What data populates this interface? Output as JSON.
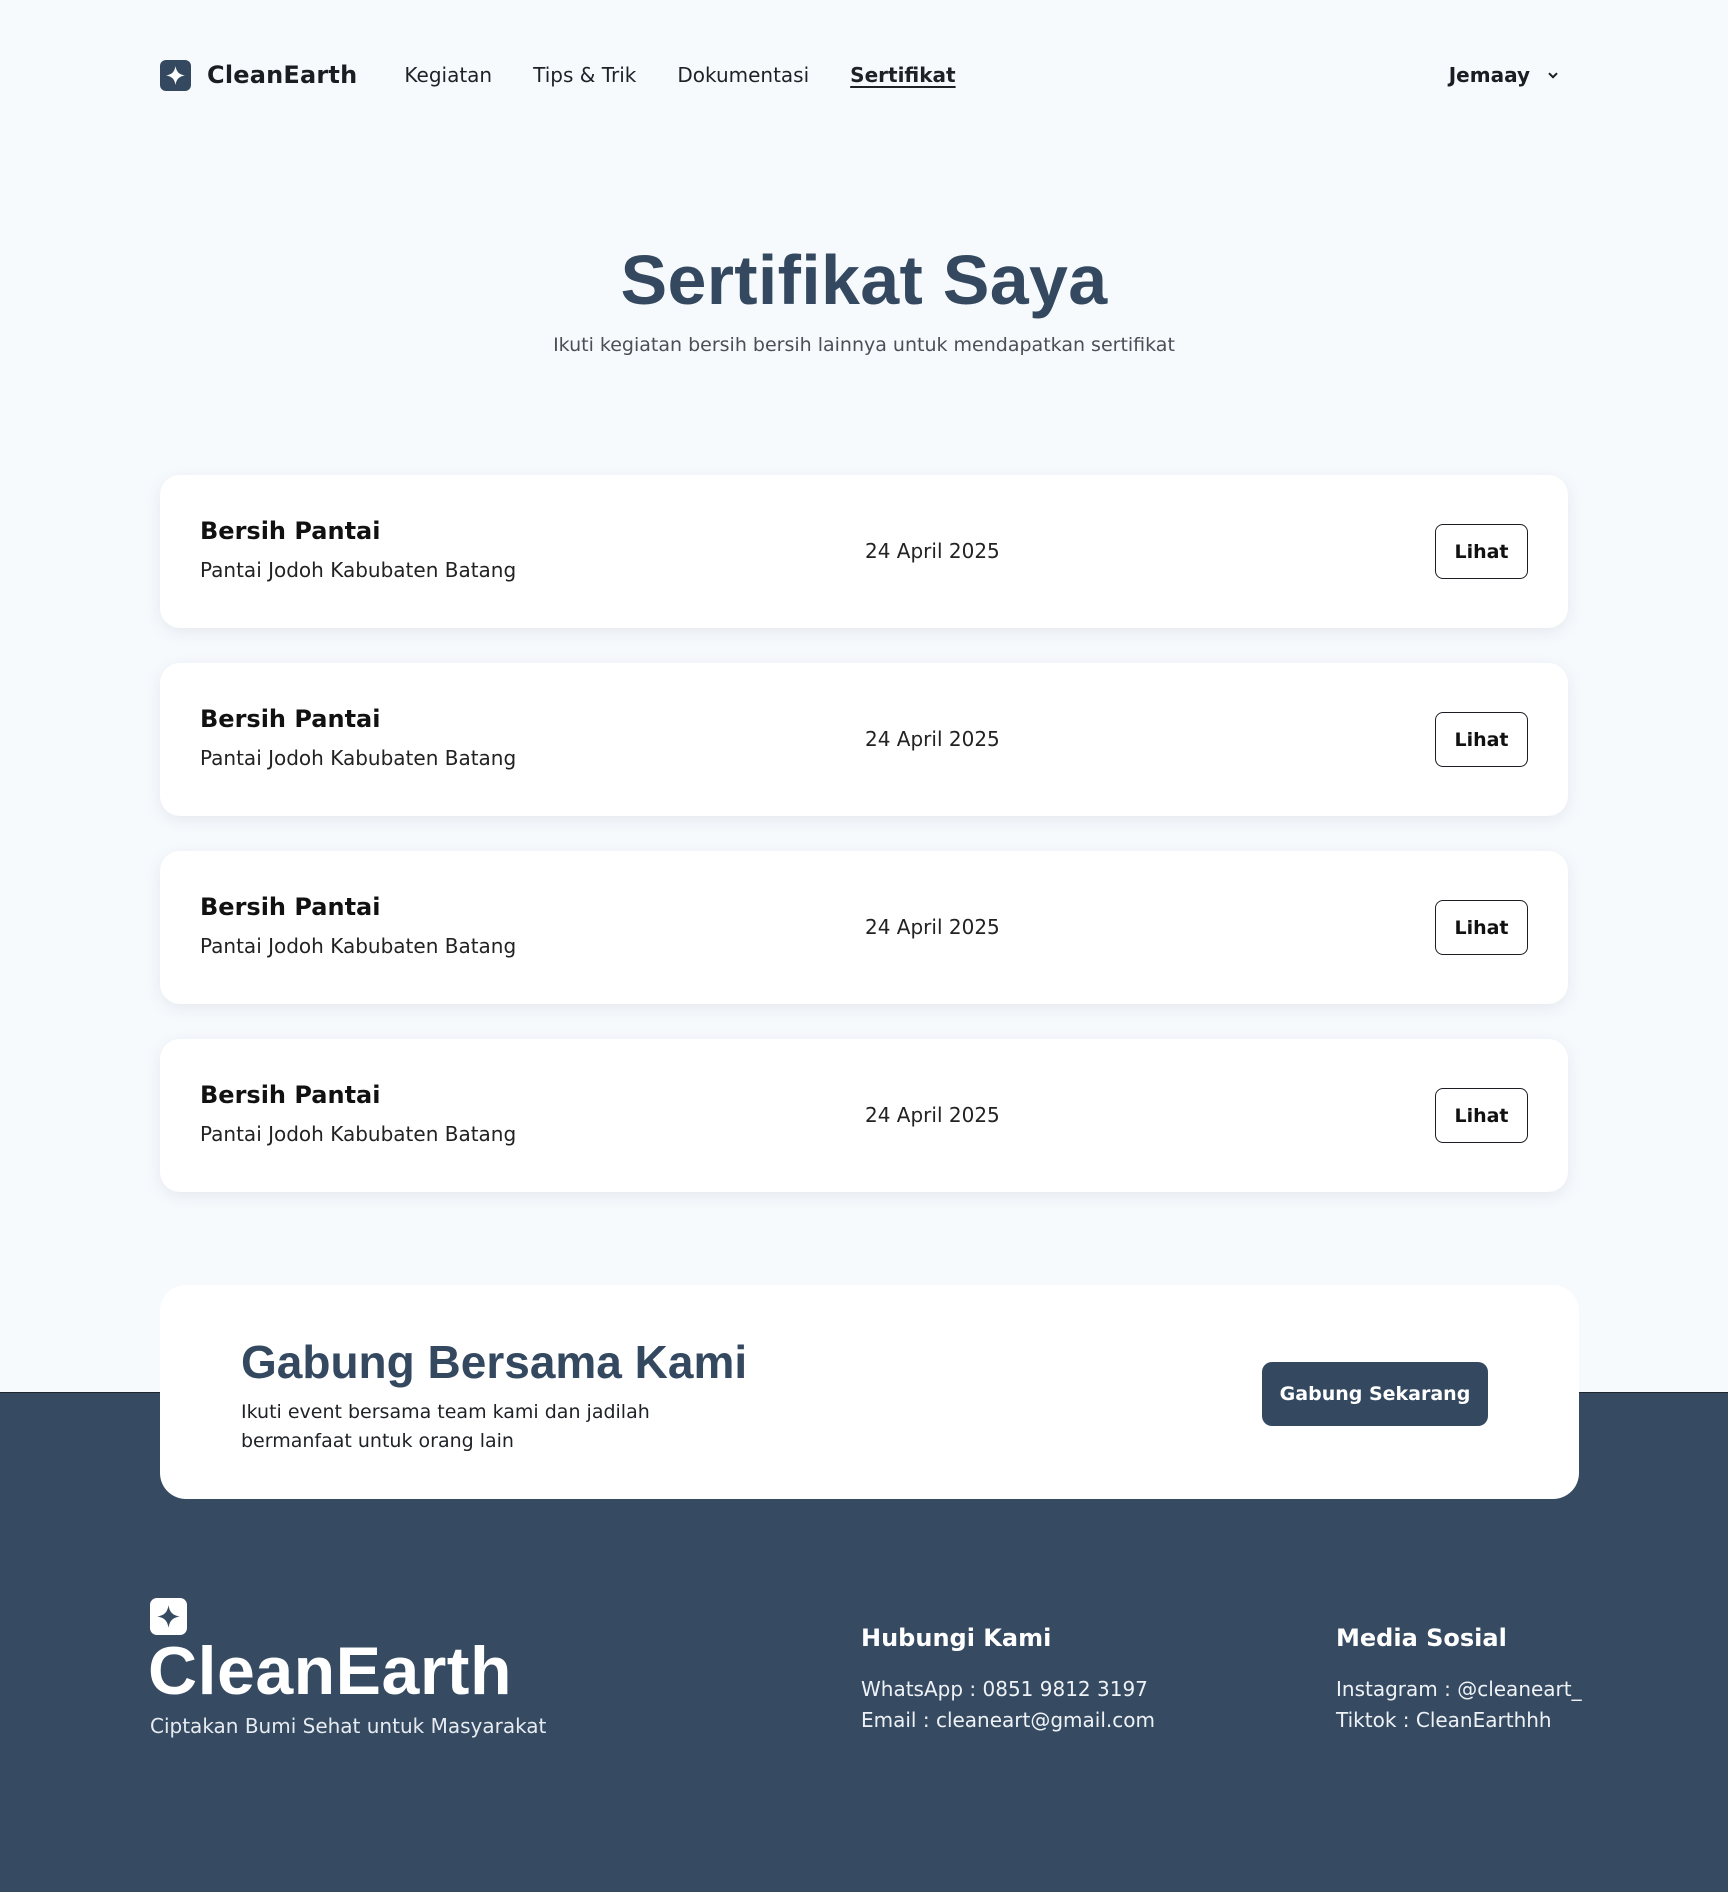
{
  "nav": {
    "brand": "CleanEarth",
    "logo_icon": "sparkle-icon",
    "items": [
      {
        "label": "Kegiatan",
        "active": false
      },
      {
        "label": "Tips & Trik",
        "active": false
      },
      {
        "label": "Dokumentasi",
        "active": false
      },
      {
        "label": "Sertifikat",
        "active": true
      }
    ],
    "user": "Jemaay",
    "user_icon": "chevron-down-icon"
  },
  "hero": {
    "title": "Sertifikat Saya",
    "subtitle": "Ikuti kegiatan bersih bersih lainnya untuk mendapatkan sertifikat"
  },
  "certificates": [
    {
      "title": "Bersih Pantai",
      "location": "Pantai Jodoh Kabubaten Batang",
      "date": "24 April 2025",
      "button": "Lihat"
    },
    {
      "title": "Bersih Pantai",
      "location": "Pantai Jodoh Kabubaten Batang",
      "date": "24 April 2025",
      "button": "Lihat"
    },
    {
      "title": "Bersih Pantai",
      "location": "Pantai Jodoh Kabubaten Batang",
      "date": "24 April 2025",
      "button": "Lihat"
    },
    {
      "title": "Bersih Pantai",
      "location": "Pantai Jodoh Kabubaten Batang",
      "date": "24 April 2025",
      "button": "Lihat"
    }
  ],
  "cta": {
    "title": "Gabung Bersama Kami",
    "text": "Ikuti event bersama team kami dan jadilah bermanfaat untuk orang lain",
    "button": "Gabung Sekarang"
  },
  "footer": {
    "brand": "CleanEarth",
    "tagline": "Ciptakan Bumi Sehat untuk Masyarakat",
    "contact": {
      "title": "Hubungi Kami",
      "whatsapp": "WhatsApp : 0851 9812 3197",
      "email": "Email : cleaneart@gmail.com"
    },
    "social": {
      "title": "Media Sosial",
      "instagram": "Instagram : @cleaneart_",
      "tiktok": "Tiktok : CleanEarthhh"
    }
  },
  "colors": {
    "primary": "#344960",
    "background": "#f7fafd",
    "footer": "#364a61"
  }
}
